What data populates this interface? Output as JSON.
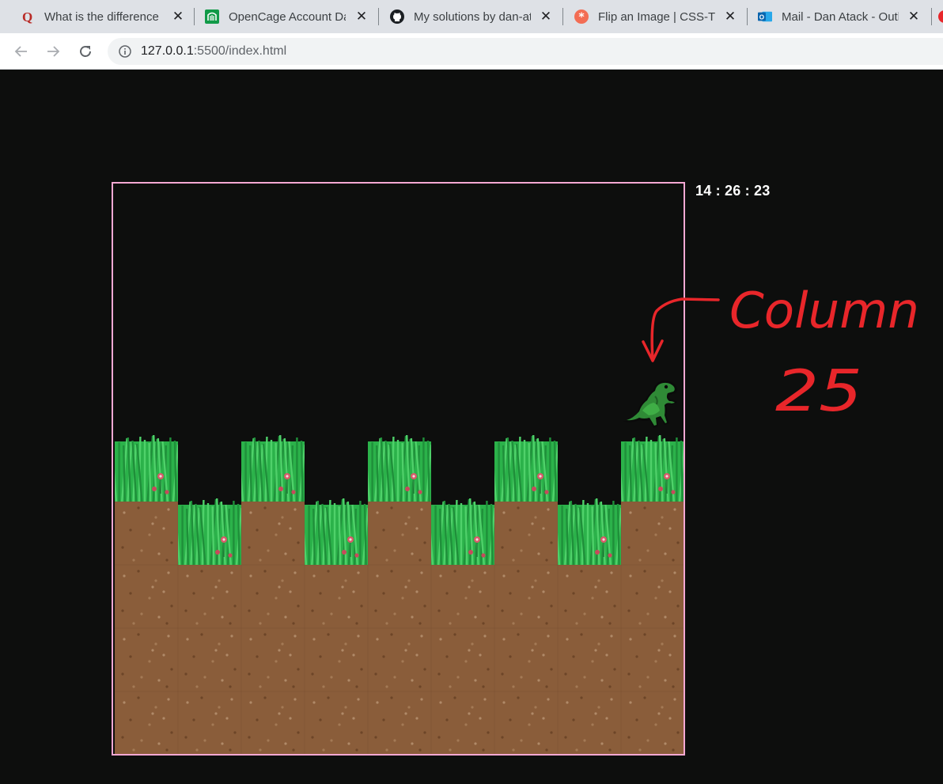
{
  "browser": {
    "tabs": [
      {
        "title": "What is the difference b",
        "favicon": "quora-icon"
      },
      {
        "title": "OpenCage Account Dash",
        "favicon": "opencage-icon"
      },
      {
        "title": "My solutions by dan-at",
        "favicon": "github-icon"
      },
      {
        "title": "Flip an Image | CSS-Tric",
        "favicon": "css-tricks-icon"
      },
      {
        "title": "Mail - Dan Atack - Outl",
        "favicon": "outlook-icon"
      }
    ],
    "close_glyph": "✕",
    "url_host": "127.0.0.1",
    "url_path": ":5500/index.html"
  },
  "game": {
    "timer": "14 : 26 : 23",
    "frame_color": "#f4a8d3",
    "grass_color": "#2bb24a",
    "dirt_color": "#8a5d3a",
    "background_color": "#0d0e0d",
    "tile_columns": 9,
    "tile_rows": 9,
    "column_surface_row": [
      4,
      5,
      4,
      5,
      4,
      5,
      4,
      5,
      4
    ],
    "player": "dino-sprite",
    "player_column_index": 8
  },
  "annotation": {
    "line1": "Column",
    "line2": "25",
    "color": "#e8262a"
  }
}
